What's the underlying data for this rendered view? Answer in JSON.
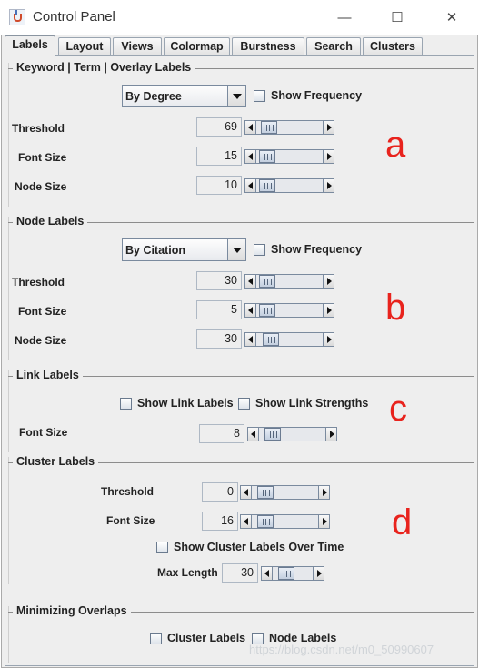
{
  "window": {
    "title": "Control Panel",
    "minimize": "—",
    "maximize": "☐",
    "close": "✕"
  },
  "tabs": [
    "Labels",
    "Layout",
    "Views",
    "Colormap",
    "Burstness",
    "Search",
    "Clusters"
  ],
  "keyword_group": {
    "title": "Keyword | Term | Overlay Labels",
    "combo": "By Degree",
    "show_frequency": "Show Frequency",
    "threshold": {
      "label": "Threshold",
      "value": "69",
      "level": 0.08
    },
    "font_size": {
      "label": "Font Size",
      "value": "15",
      "level": 0.04
    },
    "node_size": {
      "label": "Node Size",
      "value": "10",
      "level": 0.04
    }
  },
  "node_group": {
    "title": "Node Labels",
    "combo": "By Citation",
    "show_frequency": "Show Frequency",
    "threshold": {
      "label": "Threshold",
      "value": "30",
      "level": 0.04
    },
    "font_size": {
      "label": "Font Size",
      "value": "5",
      "level": 0.04
    },
    "node_size": {
      "label": "Node Size",
      "value": "30",
      "level": 0.12
    }
  },
  "link_group": {
    "title": "Link Labels",
    "show_link_labels": "Show Link Labels",
    "show_link_strengths": "Show Link Strengths",
    "font_size": {
      "label": "Font Size",
      "value": "8",
      "level": 0.1
    }
  },
  "cluster_group": {
    "title": "Cluster Labels",
    "threshold": {
      "label": "Threshold",
      "value": "0",
      "level": 0.1
    },
    "font_size": {
      "label": "Font Size",
      "value": "16",
      "level": 0.1
    },
    "show_over_time": "Show Cluster Labels Over Time",
    "max_length": {
      "label": "Max Length",
      "value": "30",
      "level": 0.22
    }
  },
  "minimize_group": {
    "title": "Minimizing Overlaps",
    "cluster_labels": "Cluster Labels",
    "node_labels": "Node Labels"
  },
  "annotations": {
    "a": "a",
    "b": "b",
    "c": "c",
    "d": "d"
  },
  "watermark": "https://blog.csdn.net/m0_50990607",
  "colors": {
    "annotation": "#e8231d",
    "panel_bg": "#eeeeee"
  }
}
